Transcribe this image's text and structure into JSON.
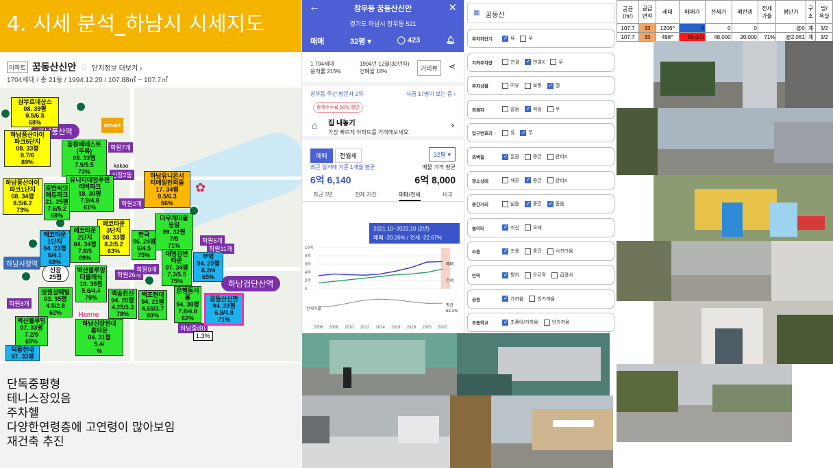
{
  "slide": {
    "title": "4. 시세 분석_하남시 시세지도",
    "apt_badge": "아파트",
    "apt_name": "꿈동산신안",
    "apt_more": "단지정보 더보기",
    "apt_sub": "1704세대 / 총 21동 / 1994.12.20 / 107.88㎡ ~ 107.7㎡"
  },
  "map": {
    "stations": [
      "하남풍산역",
      "하남시청역",
      "하남검단산역"
    ],
    "emart": "emart",
    "kakao": "kakao",
    "home": "Home",
    "tags": [
      {
        "text": "삼부르네상스\n08. 39평\n9.5/6.5\n68%"
      },
      {
        "text": "하남풍산아이\n파크5단지\n08. 33평\n8.7/6\n69%"
      },
      {
        "text": "동원베네스트\n(주복)\n08. 33평\n7.5/5.5\n73%"
      },
      {
        "text": "유니티대명루첸\n리버파크\n18. 30평\n7.9/4.8\n61%"
      },
      {
        "text": "하남풍산아이\n파크1단지\n08. 34평\n8.5/6.2\n73%"
      },
      {
        "text": "호반써밋\n에듀파크\n21. 25평\n7.6/5.2\n68%"
      },
      {
        "text": "하남유니온시\n티에일린의뜰\n17. 34평\n9.5/6.3\n66%"
      },
      {
        "text": "에코타운\n3단지\n08. 33평\n8.2/5.2\n63%"
      },
      {
        "text": "에코타운\n2단지\n04. 34평\n7.8/5\n69%"
      },
      {
        "text": "에코타운\n1단지\n04. 23평\n6/4.1\n68%"
      },
      {
        "text": "더우개마을\n동일\n99. 32평\n7/5\n71%"
      },
      {
        "text": "한국\n96. 24평\n6/4.5\n75%"
      },
      {
        "text": "대명강변\n타운\n07. 34평\n7.3/5.5\n75%"
      },
      {
        "text": "부영\n94. 25평\n6.2/4\n65%"
      },
      {
        "text": "꿈동산신안\n94. 33평\n6.8/4.8\n71%"
      },
      {
        "text": "은행동서\n울\n94. 38평\n7.8/4.8\n62%"
      },
      {
        "text": "백조현대\n94. 21평\n4.65/3.7\n80%"
      },
      {
        "text": "백송한신\n94. 20평\n4.25/3.3\n78%"
      },
      {
        "text": "벽산블루밍\n더클래식\n10. 35평\n5.6/4.4\n79%"
      },
      {
        "text": "성원상떼빌\n03. 35평\n4.5/2.8\n62%"
      },
      {
        "text": "벽산블루밍\n07. 33평\n7.2/5\n69%"
      },
      {
        "text": "하남신장현대\n홈타운\n04. 31평\n5.4/\n%"
      },
      {
        "text": "덕풍현대\n97. 33평"
      },
      {
        "text": "신장\n25평"
      }
    ],
    "schools": [
      "학원7개",
      "학원2개",
      "학원11개",
      "학원26개",
      "학원8개",
      "학원9개",
      "학원6개",
      "신장2동",
      "하남중(B)",
      "1.3%"
    ]
  },
  "notes": [
    "단독중평형",
    "테니스장있음",
    "주차헬",
    "다양한연령층에 고연령이 많아보임",
    "재건축 추진"
  ],
  "phone1": {
    "back_icon": "arrow-left-icon",
    "title": "창우동 꿈동산신안",
    "address": "경기도 하남시 창우동 521",
    "deal": "매매",
    "size": "32평",
    "comments": "423",
    "households": "1,704세대",
    "floor_ratio": "용적률 215%",
    "built": "1994년 12월(30년차)",
    "coverage": "건폐율 18%",
    "review_btn": "거리뷰",
    "visitors": "창우동 주간 방문자 2위",
    "viewers": "지금 17명이 보는 중",
    "promo": "중개수수료 50% 할인",
    "sell_title": "집 내놓기",
    "sell_sub": "가장 빠르게 아파트를 거래해보세요.",
    "tab_a": "매매",
    "tab_b": "전월세",
    "size_dd": "32평",
    "recent_label": "최근 실거래 기준 1개월 평균",
    "recent_price": "6억 6,140",
    "ask_label": "매물 가격 평균",
    "ask_price": "6억 8,000",
    "period_tabs": [
      "최근 3년",
      "전체 기간",
      "매매/전세",
      "비교"
    ],
    "chart_tip1": "2021.10~2023.10 (2년)",
    "chart_tip2": "매매 -20.26% / 전세 -22.67%"
  },
  "phone2": {
    "search": "꿈동산",
    "rows": [
      {
        "label": "주차차단기",
        "opts": [
          {
            "t": "유",
            "on": true
          },
          {
            "t": "무",
            "on": false
          }
        ]
      },
      {
        "label": "지하주차장",
        "opts": [
          {
            "t": "연결",
            "on": false
          },
          {
            "t": "연결X",
            "on": true
          },
          {
            "t": "무",
            "on": false
          }
        ]
      },
      {
        "label": "주차상황",
        "opts": [
          {
            "t": "여유",
            "on": false
          },
          {
            "t": "보통",
            "on": false
          },
          {
            "t": "헬",
            "on": true
          }
        ]
      },
      {
        "label": "외제차",
        "opts": [
          {
            "t": "많음",
            "on": false
          },
          {
            "t": "적음",
            "on": true
          },
          {
            "t": "무",
            "on": false
          }
        ]
      },
      {
        "label": "입구번호키",
        "opts": [
          {
            "t": "유",
            "on": false
          },
          {
            "t": "무",
            "on": true
          }
        ]
      },
      {
        "label": "외벽칠",
        "opts": [
          {
            "t": "깔끔",
            "on": true
          },
          {
            "t": "중간",
            "on": false
          },
          {
            "t": "관리X",
            "on": false
          }
        ]
      },
      {
        "label": "청소상태",
        "opts": [
          {
            "t": "깨끗",
            "on": false
          },
          {
            "t": "중간",
            "on": true
          },
          {
            "t": "관리X",
            "on": false
          }
        ]
      },
      {
        "label": "동간거리",
        "opts": [
          {
            "t": "넓음",
            "on": false
          },
          {
            "t": "중간",
            "on": true
          },
          {
            "t": "좁음",
            "on": true
          }
        ]
      },
      {
        "label": "놀이터",
        "opts": [
          {
            "t": "최신",
            "on": true
          },
          {
            "t": "오래",
            "on": false
          }
        ]
      },
      {
        "label": "소음",
        "opts": [
          {
            "t": "조용",
            "on": true
          },
          {
            "t": "중간",
            "on": false
          },
          {
            "t": "시끄러움",
            "on": false
          }
        ]
      },
      {
        "label": "언덕",
        "opts": [
          {
            "t": "평지",
            "on": true
          },
          {
            "t": "오르막",
            "on": false
          },
          {
            "t": "급경사",
            "on": false
          }
        ]
      },
      {
        "label": "공원",
        "opts": [
          {
            "t": "가까움",
            "on": true
          },
          {
            "t": "안가까움",
            "on": false
          }
        ]
      },
      {
        "label": "초등학교",
        "opts": [
          {
            "t": "초품아/가까움",
            "on": true
          },
          {
            "t": "안가까움",
            "on": false
          }
        ]
      }
    ]
  },
  "table": {
    "headers": [
      "공급\n(m²)",
      "공급\n면적",
      "세대",
      "매매가",
      "전세가",
      "매전갭",
      "전세\n가율",
      "평단가",
      "구\n조",
      "방/\n욕실"
    ],
    "rows": [
      [
        "107.7",
        "33",
        "1206^",
        "0",
        "0",
        "0",
        "",
        "@0",
        "계",
        "3/2"
      ],
      [
        "107.7",
        "33",
        "498^",
        "68,000",
        "48,000",
        "20,000",
        "71%",
        "@2,061",
        "계",
        "3/2"
      ]
    ]
  },
  "chart_data": {
    "type": "line",
    "x": [
      2006,
      2008,
      2010,
      2012,
      2014,
      2016,
      2018,
      2020,
      2022
    ],
    "ylim": [
      0,
      10
    ],
    "series": [
      {
        "name": "매매",
        "values": [
          3.2,
          3.6,
          3.4,
          3.3,
          3.6,
          4.3,
          5.2,
          6.5,
          6.6
        ]
      },
      {
        "name": "전세",
        "values": [
          1.4,
          1.8,
          2.2,
          2.6,
          3.0,
          3.4,
          3.6,
          4.0,
          4.8
        ]
      },
      {
        "name": "전세가율",
        "values": [
          45,
          50,
          64,
          78,
          83,
          79,
          69,
          62,
          63
        ]
      }
    ],
    "tick_labels_y": [
      "10억",
      "8억",
      "6억",
      "4억",
      "2억",
      "0"
    ],
    "tick_labels_x": [
      "2006",
      "2008",
      "2010",
      "2012",
      "2014",
      "2016",
      "2018",
      "2020",
      "2022"
    ],
    "right_labels": [
      "매매",
      "전세",
      "평균",
      "63.1%"
    ],
    "bottom_label": "전세가율",
    "colors": {
      "sale": "#2c34c9",
      "jeonse": "#28a06a",
      "ratio": "#888888",
      "highlight": "#f5a892"
    }
  }
}
